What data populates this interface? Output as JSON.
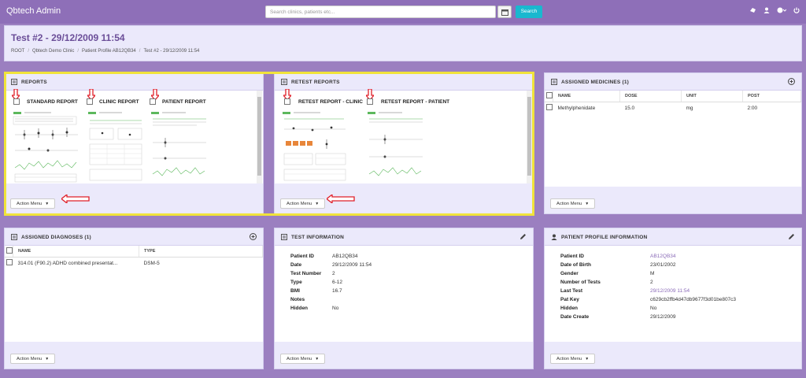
{
  "app": {
    "title": "Qbtech Admin"
  },
  "search": {
    "placeholder": "Search clinics, patients etc...",
    "button": "Search"
  },
  "page": {
    "title": "Test #2 - 29/12/2009 11:54",
    "breadcrumb": [
      "ROOT",
      "Qbtech Demo Clinic",
      "Patient Profile AB12QB34",
      "Test #2 - 29/12/2009 11:54"
    ]
  },
  "action_menu": "Action Menu",
  "reports": {
    "title": "REPORTS",
    "items": [
      "STANDARD REPORT",
      "CLINIC REPORT",
      "PATIENT REPORT"
    ]
  },
  "retest": {
    "title": "RETEST REPORTS",
    "items": [
      "RETEST REPORT - CLINIC",
      "RETEST REPORT - PATIENT"
    ]
  },
  "medicines": {
    "title": "ASSIGNED MEDICINES (1)",
    "columns": [
      "NAME",
      "DOSE",
      "UNIT",
      "POST"
    ],
    "rows": [
      [
        "Methylphenidate",
        "15.0",
        "mg",
        "2:00"
      ]
    ]
  },
  "diagnoses": {
    "title": "ASSIGNED DIAGNOSES (1)",
    "columns": [
      "NAME",
      "TYPE"
    ],
    "rows": [
      [
        "314.01 (F90.2) ADHD combined presentat...",
        "DSM-5"
      ]
    ]
  },
  "test_info": {
    "title": "TEST INFORMATION",
    "fields": [
      {
        "k": "Patient ID",
        "v": "AB12QB34"
      },
      {
        "k": "Date",
        "v": "29/12/2009 11:54"
      },
      {
        "k": "Test Number",
        "v": "2"
      },
      {
        "k": "Type",
        "v": "6-12"
      },
      {
        "k": "BMI",
        "v": "16.7"
      },
      {
        "k": "Notes",
        "v": ""
      },
      {
        "k": "Hidden",
        "v": "No"
      }
    ]
  },
  "patient_info": {
    "title": "PATIENT PROFILE INFORMATION",
    "fields": [
      {
        "k": "Patient ID",
        "v": "AB12QB34"
      },
      {
        "k": "Date of Birth",
        "v": "23/01/2002"
      },
      {
        "k": "Gender",
        "v": "M"
      },
      {
        "k": "Number of Tests",
        "v": "2"
      },
      {
        "k": "Last Test",
        "v": "29/12/2009 11:54"
      },
      {
        "k": "Pat Key",
        "v": "c629cb2ffb4d47db9677f3d01be807c3"
      },
      {
        "k": "Hidden",
        "v": "No"
      },
      {
        "k": "Date Create",
        "v": "29/12/2009"
      }
    ]
  },
  "colors": {
    "accent": "#8e6fb8",
    "search_button": "#19b8cf",
    "highlight": "#f0e33a",
    "arrow": "#e0202a"
  }
}
